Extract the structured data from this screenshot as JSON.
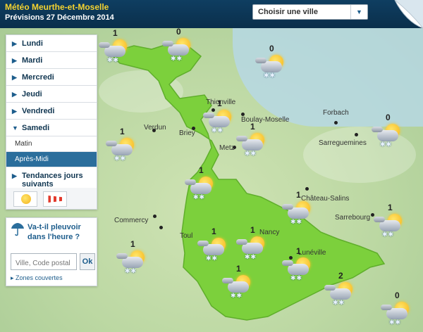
{
  "header": {
    "title": "Météo Meurthe-et-Moselle",
    "subtitle": "Prévisions 27 Décembre 2014",
    "city_select": "Choisir une ville"
  },
  "sidebar": {
    "days": [
      {
        "label": "Lundi",
        "expanded": false
      },
      {
        "label": "Mardi",
        "expanded": false
      },
      {
        "label": "Mercredi",
        "expanded": false
      },
      {
        "label": "Jeudi",
        "expanded": false
      },
      {
        "label": "Vendredi",
        "expanded": false
      },
      {
        "label": "Samedi",
        "expanded": true
      }
    ],
    "periods": [
      "Matin",
      "Après-Midi"
    ],
    "trends": "Tendances jours suivants",
    "icon_buttons": [
      "sun-icon",
      "windsock-icon"
    ]
  },
  "rain": {
    "title": "Va-t-il pleuvoir dans l'heure ?",
    "placeholder": "Ville, Code postal",
    "ok": "Ok",
    "zones": "Zones couvertes"
  },
  "cities": [
    "Thionville",
    "Briey",
    "Boulay-Moselle",
    "Forbach",
    "Verdun",
    "Metz",
    "Sarreguemines",
    "Château-Salins",
    "Sarrebourg",
    "Commercy",
    "Toul",
    "Nancy",
    "Lunéville"
  ],
  "forecast_values": [
    "1",
    "0",
    "0",
    "1",
    "1",
    "0",
    "1",
    "1",
    "1",
    "1",
    "1",
    "1",
    "1",
    "1",
    "1",
    "2",
    "1",
    "0"
  ],
  "colors": {
    "header_bg": "#0f3e61",
    "title": "#f5d330",
    "active_period": "#2b6e9c",
    "region_fill": "#7cd03c"
  }
}
